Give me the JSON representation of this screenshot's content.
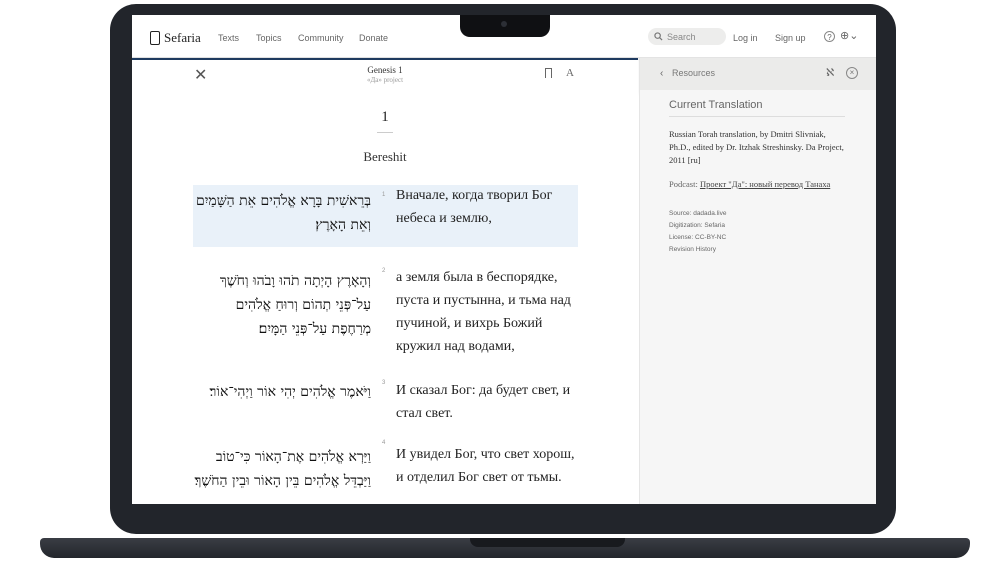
{
  "nav": {
    "logo": "Sefaria",
    "links": [
      "Texts",
      "Topics",
      "Community",
      "Donate"
    ],
    "search_placeholder": "Search",
    "login": "Log in",
    "signup": "Sign up",
    "help": "?",
    "globe": "⊕⌄"
  },
  "reader": {
    "title": "Genesis 1",
    "subtitle": "«Да» project",
    "font_button": "A",
    "chapter_number": "1",
    "section_title": "Bereshit",
    "verses": [
      {
        "num": "1",
        "hebrew": "בְּרֵאשִׁית בָּרָא אֱלֹהִים אֵת הַשָּׁמַיִם וְאֵת הָאָרֶץ׃",
        "russian": "Вначале, когда творил Бог небеса и землю,"
      },
      {
        "num": "2",
        "hebrew": "וְהָאָרֶץ הָיְתָה תֹהוּ וָבֹהוּ וְחֹשֶׁךְ עַל־פְּנֵי תְהוֹם וְרוּחַ אֱלֹהִים מְרַחֶפֶת עַל־פְּנֵי הַמָּיִם׃",
        "russian": "а земля была в беспорядке, пуста и пустынна, и тьма над пучиной, и вихрь Божий кружил над водами,"
      },
      {
        "num": "3",
        "hebrew": "וַיֹּאמֶר אֱלֹהִים יְהִי אוֹר וַיְהִי־אוֹר׃",
        "russian": "И сказал Бог: да будет свет, и стал свет."
      },
      {
        "num": "4",
        "hebrew": "וַיַּרְא אֱלֹהִים אֶת־הָאוֹר כִּי־טוֹב וַיַּבְדֵּל אֱלֹהִים בֵּין הָאוֹר וּבֵין הַחֹשֶׁךְ׃",
        "russian": "И увидел Бог, что свет хорош, и отделил Бог свет от тьмы."
      }
    ]
  },
  "sidebar": {
    "resources_label": "Resources",
    "alef": "ℵ",
    "close": "×",
    "heading": "Current Translation",
    "description": "Russian Torah translation, by Dmitri Slivniak, Ph.D., edited by Dr. Itzhak Streshinsky. Da Project, 2011 [ru]",
    "podcast_label": "Podcast: ",
    "podcast_link": "Проект \"Да\": новый перевод Танаха",
    "source": "Source: dadada.live",
    "digitization": "Digitization: Sefaria",
    "license": "License: CC-BY-NC",
    "revision": "Revision History"
  },
  "colors": {
    "accent": "#1e3a5f",
    "highlight": "#e9f1f9",
    "sidebar_bg": "#f6f6f6"
  }
}
